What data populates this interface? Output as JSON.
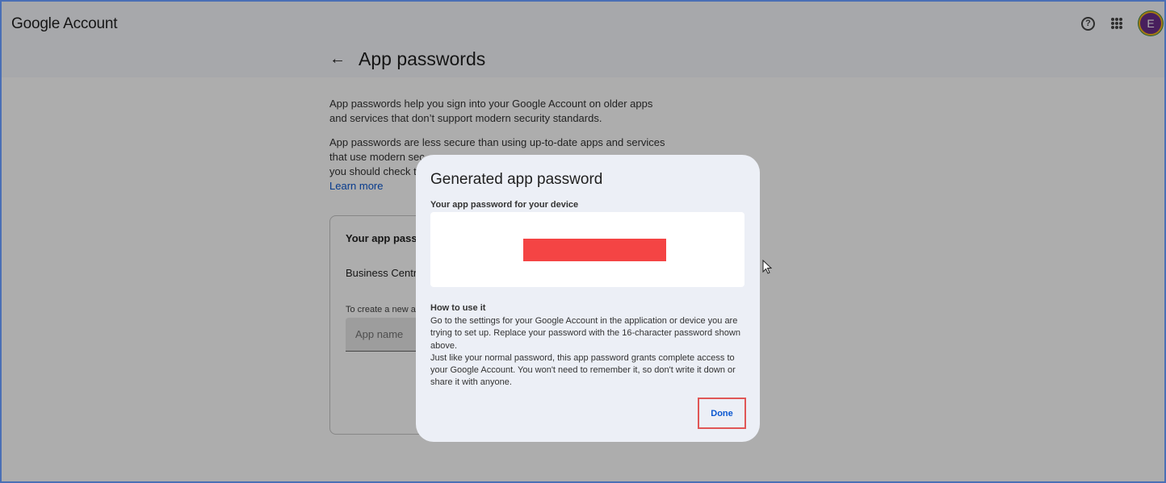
{
  "header": {
    "brand_google": "Google",
    "brand_account": "Account",
    "help_icon_glyph": "?",
    "avatar_letter": "E"
  },
  "page": {
    "title": "App passwords",
    "intro_1": "App passwords help you sign into your Google Account on older apps and services that don’t support modern security standards.",
    "intro_2": "App passwords are less secure than using up-to-date apps and services that use modern sec",
    "intro_3": "you should check to",
    "learn_more": "Learn more"
  },
  "card": {
    "heading": "Your app passw",
    "item": "Business Centra",
    "hint": "To create a new ap",
    "input_placeholder": "App name"
  },
  "dialog": {
    "title": "Generated app password",
    "password_label": "Your app password for your device",
    "howto_title": "How to use it",
    "howto_p1": "Go to the settings for your Google Account in the application or device you are trying to set up. Replace your password with the 16-character password shown above.",
    "howto_p2": "Just like your normal password, this app password grants complete access to your Google Account. You won't need to remember it, so don't write it down or share it with anyone.",
    "done_label": "Done"
  },
  "colors": {
    "accent": "#0b57d0",
    "redaction": "#f44444",
    "highlight": "#e05656"
  }
}
